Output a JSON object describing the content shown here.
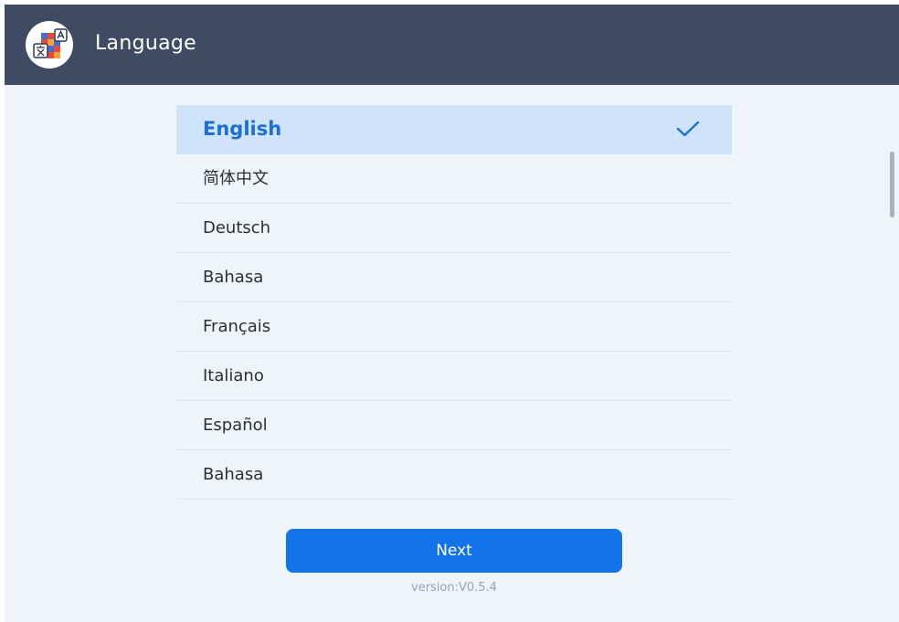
{
  "header": {
    "title": "Language",
    "icon": "language-translate-icon"
  },
  "languages": [
    {
      "label": "English",
      "selected": true
    },
    {
      "label": "简体中文",
      "selected": false
    },
    {
      "label": "Deutsch",
      "selected": false
    },
    {
      "label": "Bahasa",
      "selected": false
    },
    {
      "label": "Français",
      "selected": false
    },
    {
      "label": "Italiano",
      "selected": false
    },
    {
      "label": "Español",
      "selected": false
    },
    {
      "label": "Bahasa",
      "selected": false
    }
  ],
  "next_button": {
    "label": "Next"
  },
  "version": "version:V0.5.4",
  "colors": {
    "header_bg": "#3e4b63",
    "page_bg": "#eff4fb",
    "selected_bg": "#cfe3fa",
    "accent": "#1373e8",
    "selected_text": "#1c6fd4"
  }
}
